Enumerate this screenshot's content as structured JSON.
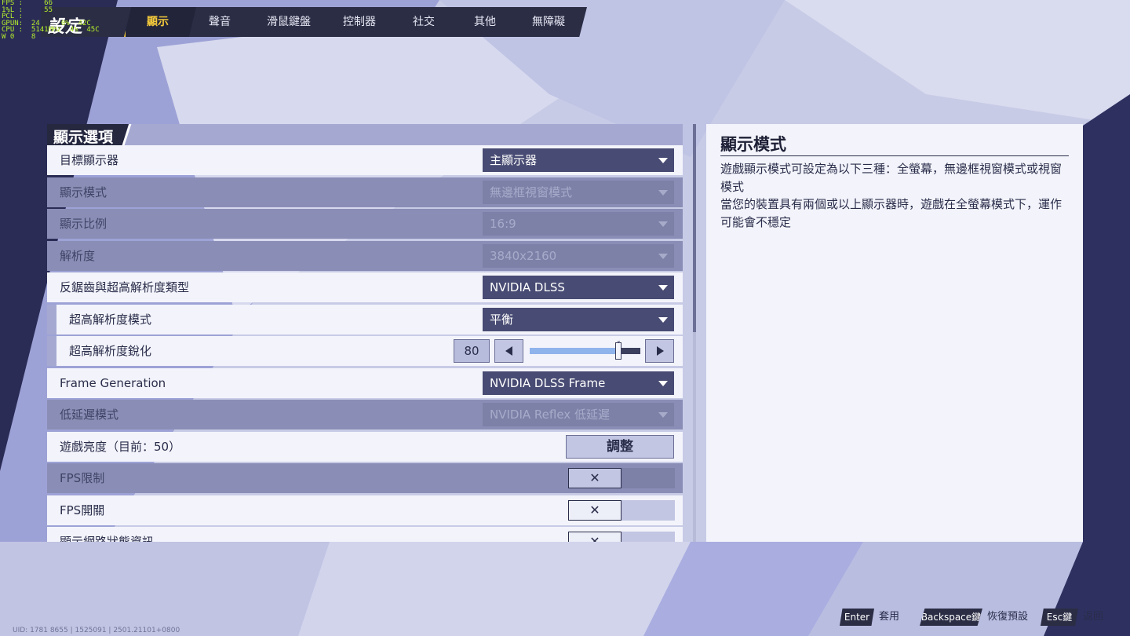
{
  "overlay": {
    "stats_text": "FPS :     66\n1%L :     55\nPCL :\nGPUN:  24     0%  42C\nCPU :  5141MHz  4%  45C\nW 0    8"
  },
  "header": {
    "title": "設定",
    "tabs": [
      {
        "label": "顯示",
        "active": true
      },
      {
        "label": "聲音",
        "active": false
      },
      {
        "label": "滑鼠鍵盤",
        "active": false
      },
      {
        "label": "控制器",
        "active": false
      },
      {
        "label": "社交",
        "active": false
      },
      {
        "label": "其他",
        "active": false
      },
      {
        "label": "無障礙",
        "active": false
      }
    ]
  },
  "panel": {
    "title": "顯示選項",
    "rows": {
      "target_display": {
        "label": "目標顯示器",
        "value": "主顯示器"
      },
      "display_mode": {
        "label": "顯示模式",
        "value": "無邊框視窗模式"
      },
      "aspect_ratio": {
        "label": "顯示比例",
        "value": "16:9"
      },
      "resolution": {
        "label": "解析度",
        "value": "3840x2160"
      },
      "aa_type": {
        "label": "反鋸齒與超高解析度類型",
        "value": "NVIDIA DLSS"
      },
      "sr_mode": {
        "label": "超高解析度模式",
        "value": "平衡"
      },
      "sr_sharpen": {
        "label": "超高解析度銳化",
        "value": "80",
        "fraction": 0.8
      },
      "frame_gen": {
        "label": "Frame Generation",
        "value": "NVIDIA DLSS Frame Generation"
      },
      "low_latency": {
        "label": "低延遲模式",
        "value": "NVIDIA Reflex 低延遲"
      },
      "brightness": {
        "label": "遊戲亮度（目前：50）",
        "button": "調整"
      },
      "fps_limit": {
        "label": "FPS限制",
        "mark": "✕"
      },
      "fps_toggle": {
        "label": "FPS開關",
        "mark": "✕"
      },
      "network_info": {
        "label": "顯示網路狀態資訊",
        "mark": "✕"
      }
    }
  },
  "info": {
    "title": "顯示模式",
    "lines": [
      "遊戲顯示模式可設定為以下三種：全螢幕，無邊框視窗模式或視窗模式",
      "當您的裝置具有兩個或以上顯示器時，遊戲在全螢幕模式下，運作可能會不穩定"
    ]
  },
  "footer": {
    "hints": [
      {
        "key": "Enter",
        "action": "套用"
      },
      {
        "key": "Backspace鍵",
        "action": "恢復預設"
      },
      {
        "key": "Esc鍵",
        "action": "返回"
      }
    ],
    "uid": "UID: 1781 8655 | 1525091 | 2501.21101+0800"
  },
  "colors": {
    "accent": "#f3c93b",
    "nav_bg": "#2b2d45",
    "dropdown_bg": "#484b73",
    "row_bg": "#f3f4fb",
    "disabled_row_bg": "#8a8eb6",
    "stats_green": "#b6f02b"
  }
}
